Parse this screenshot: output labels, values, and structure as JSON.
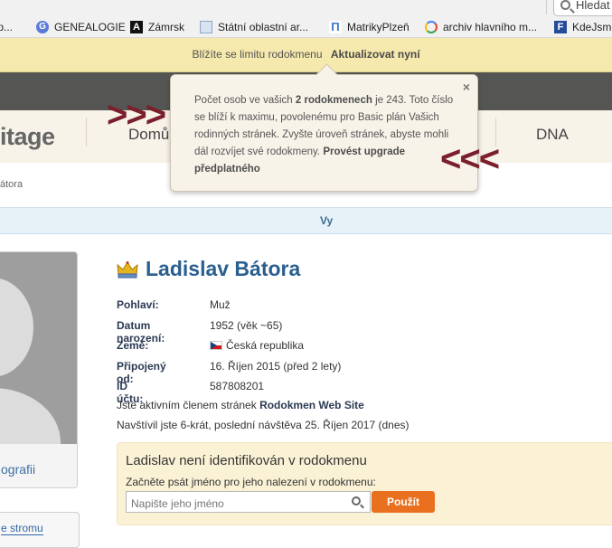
{
  "bookmarks": [
    {
      "label": ".p...",
      "icon": "page-icon"
    },
    {
      "label": "GENEALOGIE",
      "icon": "g-icon"
    },
    {
      "label": "Zámrsk",
      "icon": "a-icon"
    },
    {
      "label": "Státní oblastní ar...",
      "icon": "document-icon"
    },
    {
      "label": "MatrikyPlzeň",
      "icon": "m-icon"
    },
    {
      "label": "archiv hlavního m...",
      "icon": "google-icon"
    },
    {
      "label": "KdeJsme",
      "icon": "f-icon"
    }
  ],
  "browser_search": {
    "placeholder": "Hledat"
  },
  "notice": {
    "text": "Blížíte se limitu rodokmenu",
    "update_link": "Aktualizovat nyní"
  },
  "site": {
    "logo": "itage",
    "nav": {
      "home": "Domů",
      "dna": "DNA"
    }
  },
  "breadcrumb": "átora",
  "tabs": {
    "vy": "Vy"
  },
  "photo": {
    "link": "ografii"
  },
  "tree_link": "e stromu",
  "profile": {
    "name": "Ladislav Bátora",
    "fields": [
      {
        "label": "Pohlaví:",
        "value": "Muž"
      },
      {
        "label": "Datum narození:",
        "value": "1952 (věk ~65)"
      },
      {
        "label": "Země:",
        "value": "Česká republika",
        "flag": "cz-flag-icon"
      },
      {
        "label": "Připojený od:",
        "value": "16. Říjen 2015 (před 2 lety)"
      },
      {
        "label": "ID účtu:",
        "value": "587808201"
      }
    ],
    "member_prefix": "Jste aktivním členem stránek ",
    "member_site": "Rodokmen Web Site",
    "visits": "Navštívil jste 6-krát, poslední návštěva 25. Říjen 2017 (dnes)"
  },
  "identify": {
    "title": "Ladislav není identifikován v rodokmenu",
    "subtitle": "Začněte psát jméno pro jeho nalezení v rodokmenu:",
    "placeholder": "Napište jeho jméno",
    "button": "Použít"
  },
  "popover": {
    "close": "×",
    "text_1": "Počet osob ve vašich ",
    "text_bold_1": "2 rodokmenech",
    "text_2": " je 243. Toto číslo se blíží k maximu, povolenému pro Basic plán Vašich rodinných stránek. Zvyšte úroveň stránek, abyste mohli dál rozvíjet své rodokmeny. ",
    "text_bold_2": "Provést upgrade předplatného"
  },
  "annotation": {
    "right_arrows": ">>>",
    "left_arrows": "<<<",
    "color": "#7a1f2b"
  },
  "colors": {
    "accent_blue": "#2a5f8f",
    "button_orange": "#e8701f",
    "notice_yellow": "#f5e9ad"
  }
}
